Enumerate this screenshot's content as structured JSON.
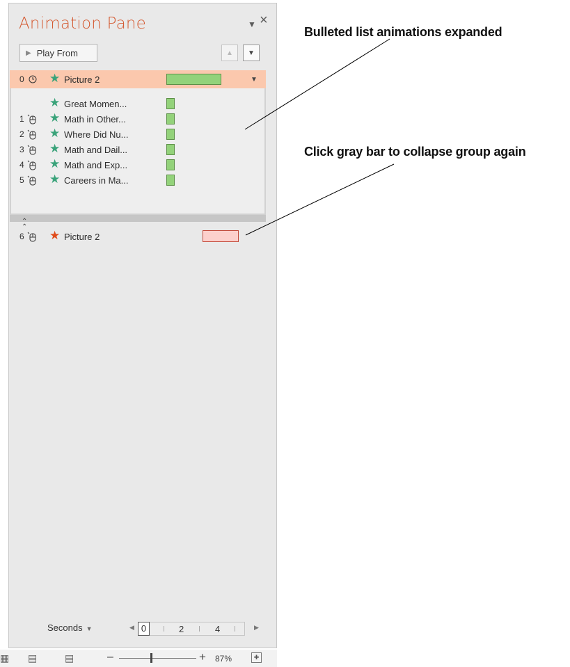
{
  "pane": {
    "title": "Animation Pane",
    "menu_icon": "dropdown-arrow-icon",
    "close_icon": "close-icon",
    "play_from_label": "Play From",
    "move_up_icon": "arrow-up-icon",
    "move_down_icon": "arrow-down-icon"
  },
  "animations": [
    {
      "num": "0",
      "trigger": "clock-icon",
      "effect": "emphasis",
      "label": "Picture 2",
      "selected": true
    },
    {
      "num": "",
      "trigger": "",
      "effect": "emphasis",
      "label": "Great Momen..."
    },
    {
      "num": "1",
      "trigger": "mouse-click-icon",
      "effect": "emphasis",
      "label": "Math in Other..."
    },
    {
      "num": "2",
      "trigger": "mouse-click-icon",
      "effect": "emphasis",
      "label": "Where Did Nu..."
    },
    {
      "num": "3",
      "trigger": "mouse-click-icon",
      "effect": "emphasis",
      "label": "Math and Dail..."
    },
    {
      "num": "4",
      "trigger": "mouse-click-icon",
      "effect": "emphasis",
      "label": "Math and Exp..."
    },
    {
      "num": "5",
      "trigger": "mouse-click-icon",
      "effect": "emphasis",
      "label": "Careers in Ma..."
    },
    {
      "num": "6",
      "trigger": "mouse-click-icon",
      "effect": "exit",
      "label": "Picture 2"
    }
  ],
  "collapse_icon": "double-chevron-up-icon",
  "timeline": {
    "unit_label": "Seconds",
    "ticks": [
      "0",
      "2",
      "4"
    ]
  },
  "status": {
    "zoom_percent": "87%"
  },
  "callouts": {
    "expanded": "Bulleted list animations expanded",
    "collapse": "Click gray bar to collapse group again"
  },
  "colors": {
    "title": "#d4582f",
    "selected_row": "#fbc8ad",
    "emphasis_star": "#3aa37a",
    "exit_star": "#e04b1a"
  }
}
